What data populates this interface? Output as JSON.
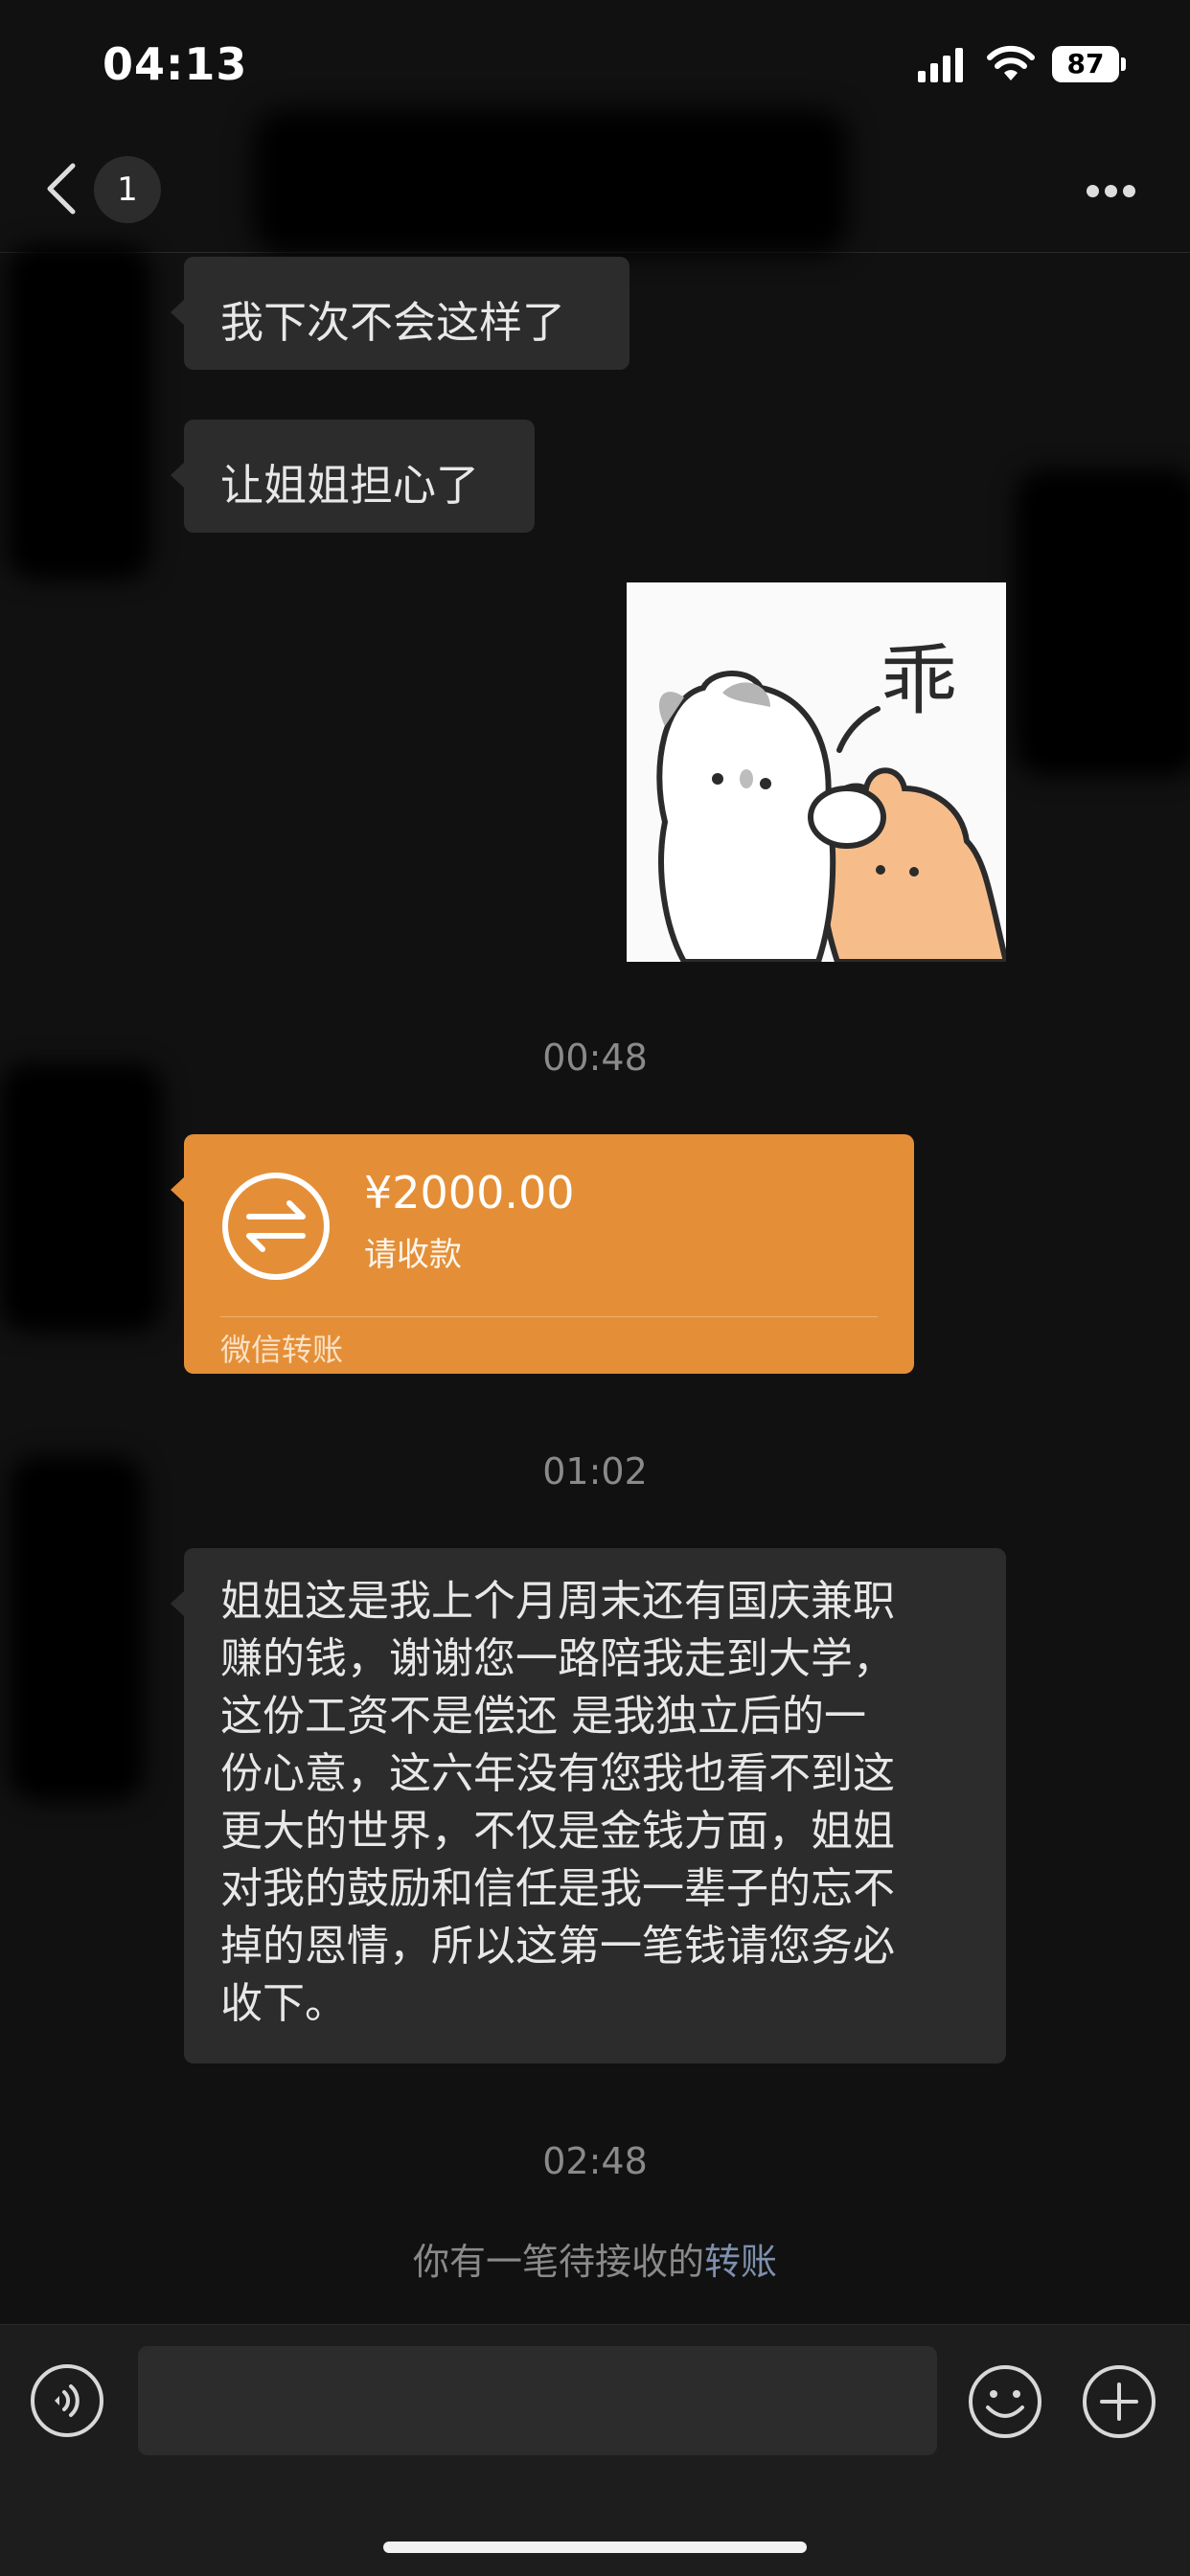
{
  "status_bar": {
    "time": "04:13",
    "battery": "87",
    "icons": [
      "cellular-signal-icon",
      "wifi-icon",
      "battery-icon"
    ]
  },
  "nav": {
    "back_icon": "chevron-left-icon",
    "unread_count": "1",
    "more_icon": "more-horizontal-icon"
  },
  "messages": [
    {
      "type": "text",
      "text": "我下次不会这样了"
    },
    {
      "type": "text",
      "text": "让姐姐担心了"
    },
    {
      "type": "sticker",
      "caption": "乖"
    },
    {
      "type": "timestamp",
      "text": "00:48"
    },
    {
      "type": "transfer",
      "amount": "¥2000.00",
      "status": "请收款",
      "source": "微信转账"
    },
    {
      "type": "timestamp",
      "text": "01:02"
    },
    {
      "type": "text",
      "lines": [
        "姐姐这是我上个月周末还有国庆兼职",
        "赚的钱，谢谢您一路陪我走到大学，",
        "这份工资不是偿还 是我独立后的一",
        "份心意，这六年没有您我也看不到这",
        "更大的世界，不仅是金钱方面，姐姐",
        "对我的鼓励和信任是我一辈子的忘不",
        "掉的恩情，所以这第一笔钱请您务必",
        "收下。"
      ]
    },
    {
      "type": "timestamp",
      "text": "02:48"
    }
  ],
  "system_notice": {
    "prefix": "你有一笔待接收的",
    "link": "转账"
  },
  "input_bar": {
    "voice_icon": "voice-icon",
    "emoji_icon": "emoji-icon",
    "plus_icon": "plus-circle-icon"
  },
  "colors": {
    "background": "#111111",
    "bubble": "#2c2c2c",
    "transfer": "#e48f37",
    "link": "#7d90ad"
  }
}
